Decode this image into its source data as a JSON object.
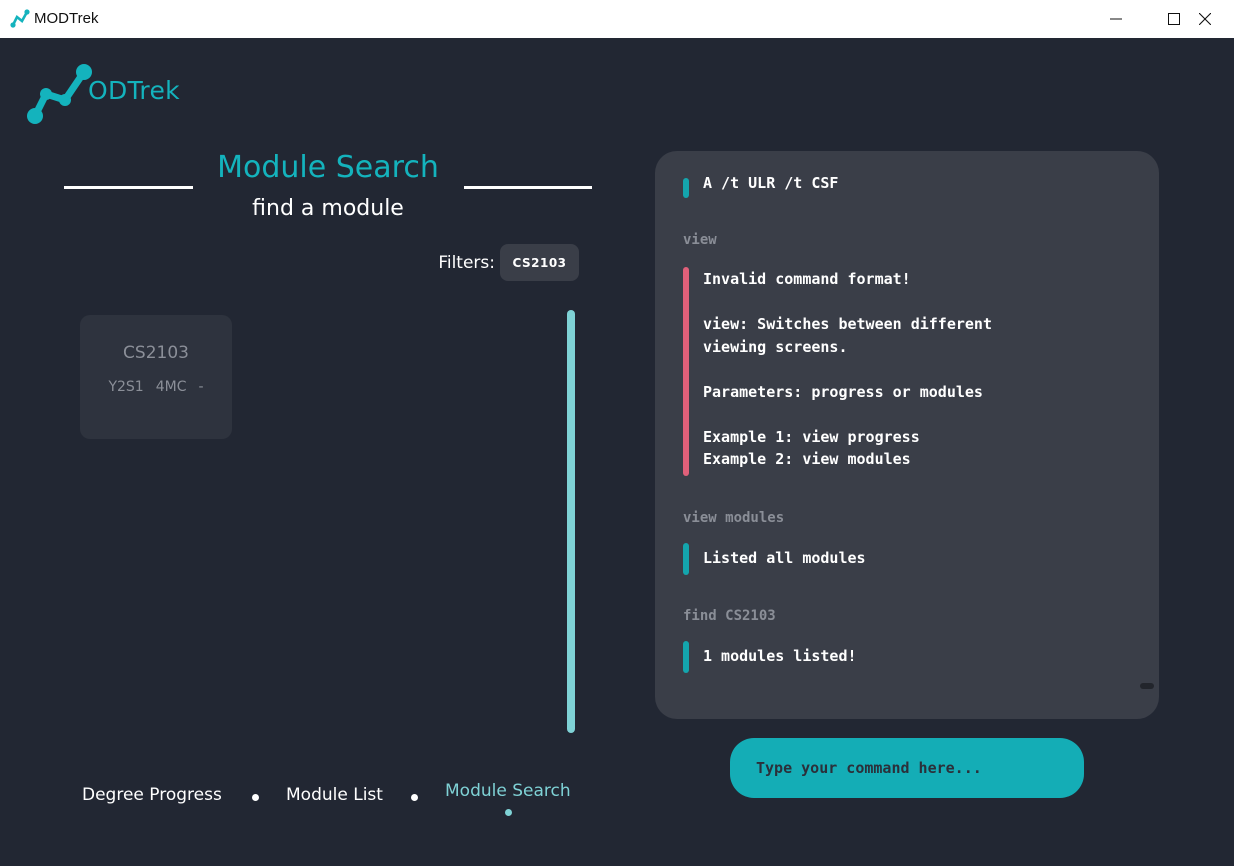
{
  "window": {
    "title": "MODTrek",
    "controls": [
      "minimize",
      "maximize",
      "close"
    ]
  },
  "logo": {
    "text": "ODTrek"
  },
  "left_panel": {
    "title": "Module Search",
    "subtitle": "find a module",
    "filters_label": "Filters:",
    "filters": [
      "CS2103"
    ],
    "modules": [
      {
        "code": "CS2103",
        "year_sem": "Y2S1",
        "credits": "4MC",
        "grade": "-"
      }
    ]
  },
  "bottom_nav": {
    "items": [
      "Degree Progress",
      "Module List",
      "Module Search"
    ],
    "active_index": 2
  },
  "console": {
    "entries": [
      {
        "kind": "result",
        "status": "success",
        "text": "A /t ULR /t CSF"
      },
      {
        "kind": "command",
        "text": "view"
      },
      {
        "kind": "result",
        "status": "error",
        "text": "Invalid command format!\n\nview: Switches between different\nviewing screens.\n\nParameters: progress or modules\n\nExample 1: view progress\nExample 2: view modules"
      },
      {
        "kind": "command",
        "text": "view modules"
      },
      {
        "kind": "result",
        "status": "success",
        "text": "Listed all modules"
      },
      {
        "kind": "command",
        "text": "find CS2103"
      },
      {
        "kind": "result",
        "status": "success",
        "text": "1 modules listed!"
      }
    ]
  },
  "command_input": {
    "placeholder": "Type your command here...",
    "value": ""
  },
  "colors": {
    "background": "#222733",
    "panel": "#3a3e48",
    "accent": "#14b3bd",
    "accent_light": "#7fd2d6",
    "error": "#e0607a"
  }
}
